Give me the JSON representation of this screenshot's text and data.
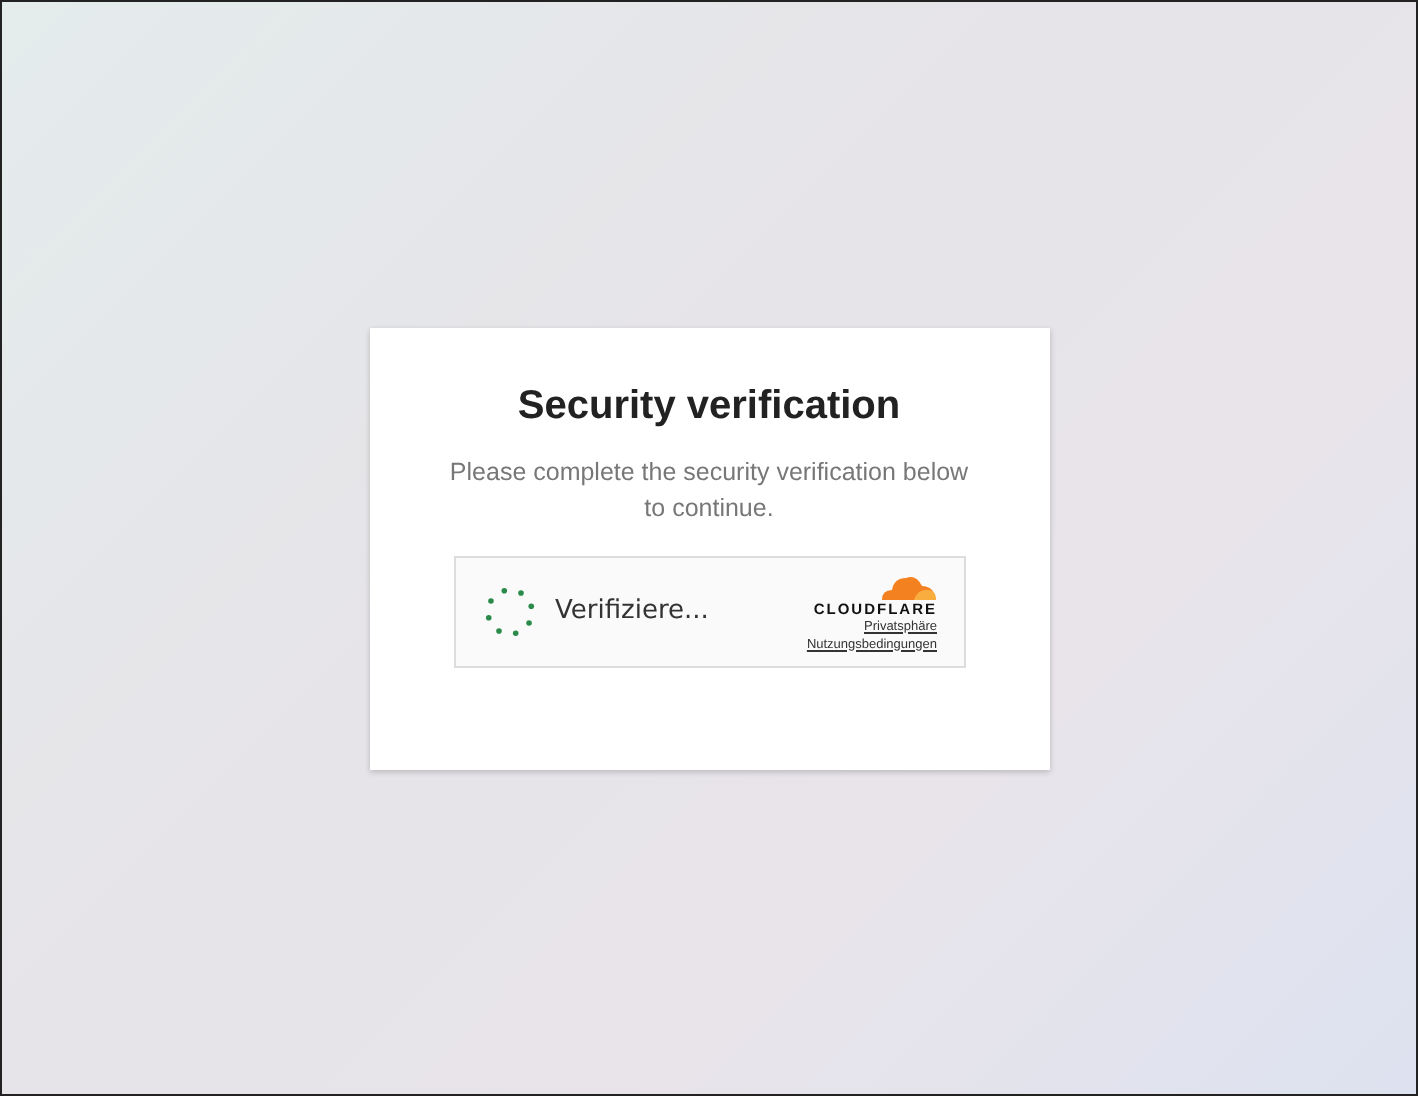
{
  "card": {
    "title": "Security verification",
    "message": "Please complete the security verification below to continue."
  },
  "widget": {
    "status": "Verifiziere...",
    "brand": "CLOUDFLARE",
    "links": [
      "Privatsphäre",
      "Nutzungsbedingungen"
    ]
  }
}
